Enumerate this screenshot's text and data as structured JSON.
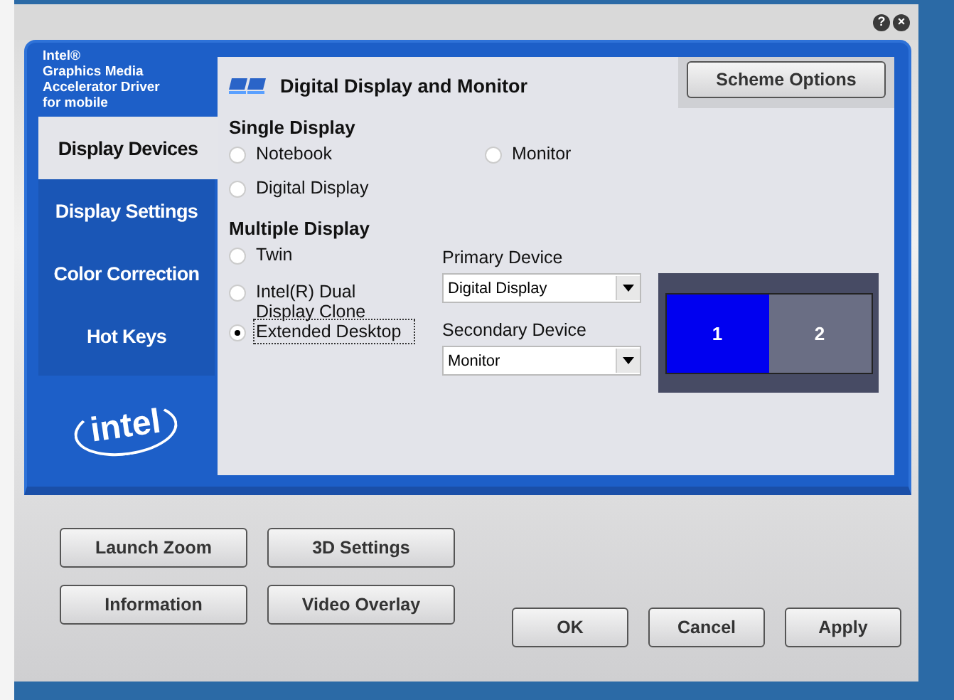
{
  "window": {
    "help_button": "?",
    "close_button": "×"
  },
  "sidebar": {
    "header": [
      "Intel®",
      "Graphics Media",
      "Accelerator Driver",
      "for mobile"
    ],
    "tabs": [
      {
        "label": "Display Devices",
        "selected": true
      },
      {
        "label": "Display Settings",
        "selected": false
      },
      {
        "label": "Color Correction",
        "selected": false
      },
      {
        "label": "Hot Keys",
        "selected": false
      }
    ],
    "logo": "intel"
  },
  "panel": {
    "title": "Digital Display and Monitor",
    "scheme_button": "Scheme Options",
    "single_display": {
      "heading": "Single Display",
      "options": [
        {
          "label": "Notebook",
          "selected": false,
          "focused": false
        },
        {
          "label": "Monitor",
          "selected": false,
          "focused": false
        },
        {
          "label": "Digital Display",
          "selected": false,
          "focused": false
        }
      ]
    },
    "multiple_display": {
      "heading": "Multiple Display",
      "options": [
        {
          "label": "Twin",
          "selected": false,
          "focused": false
        },
        {
          "label": "Intel(R) Dual Display Clone",
          "selected": false,
          "focused": false
        },
        {
          "label": "Extended Desktop",
          "selected": true,
          "focused": true
        }
      ]
    },
    "primary_device": {
      "label": "Primary Device",
      "value": "Digital Display"
    },
    "secondary_device": {
      "label": "Secondary Device",
      "value": "Monitor"
    },
    "preview": [
      {
        "label": "1",
        "selected": true
      },
      {
        "label": "2",
        "selected": false
      }
    ]
  },
  "tool_buttons": [
    "Launch Zoom",
    "3D Settings",
    "Information",
    "Video Overlay"
  ],
  "dialog_buttons": [
    "OK",
    "Cancel",
    "Apply"
  ]
}
